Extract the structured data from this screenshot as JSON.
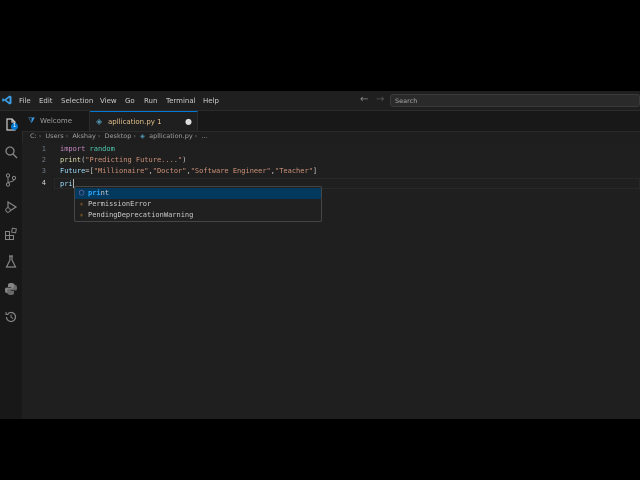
{
  "menu": [
    "File",
    "Edit",
    "Selection",
    "View",
    "Go",
    "Run",
    "Terminal",
    "Help"
  ],
  "search": {
    "placeholder": "Search"
  },
  "tabs": [
    {
      "label": "Welcome"
    },
    {
      "label": "apllication.py",
      "problems": "1",
      "dirty": "●"
    }
  ],
  "breadcrumb": [
    "C:",
    "Users",
    "Akshay",
    "Desktop",
    "apllication.py",
    "..."
  ],
  "activity_badge": "1",
  "editor": {
    "line_numbers": [
      "1",
      "2",
      "3",
      "4"
    ],
    "lines": [
      "import random",
      "print(\"Predicting Future....\")",
      "Future=[\"Millionaire\",\"Doctor\",\"Software Engineer\",\"Teacher\"]",
      "pri"
    ]
  },
  "suggest": {
    "items": [
      {
        "label": "print",
        "match": "pri",
        "rest": "nt",
        "icon": "function-cube-icon"
      },
      {
        "label": "PermissionError",
        "icon": "class-icon"
      },
      {
        "label": "PendingDeprecationWarning",
        "icon": "class-icon"
      }
    ]
  },
  "colors": {
    "accent": "#0078d4",
    "keyword": "#c586c0",
    "function": "#dcdcaa",
    "string": "#ce9178",
    "variable": "#9cdcfe",
    "module": "#4ec9b0"
  }
}
